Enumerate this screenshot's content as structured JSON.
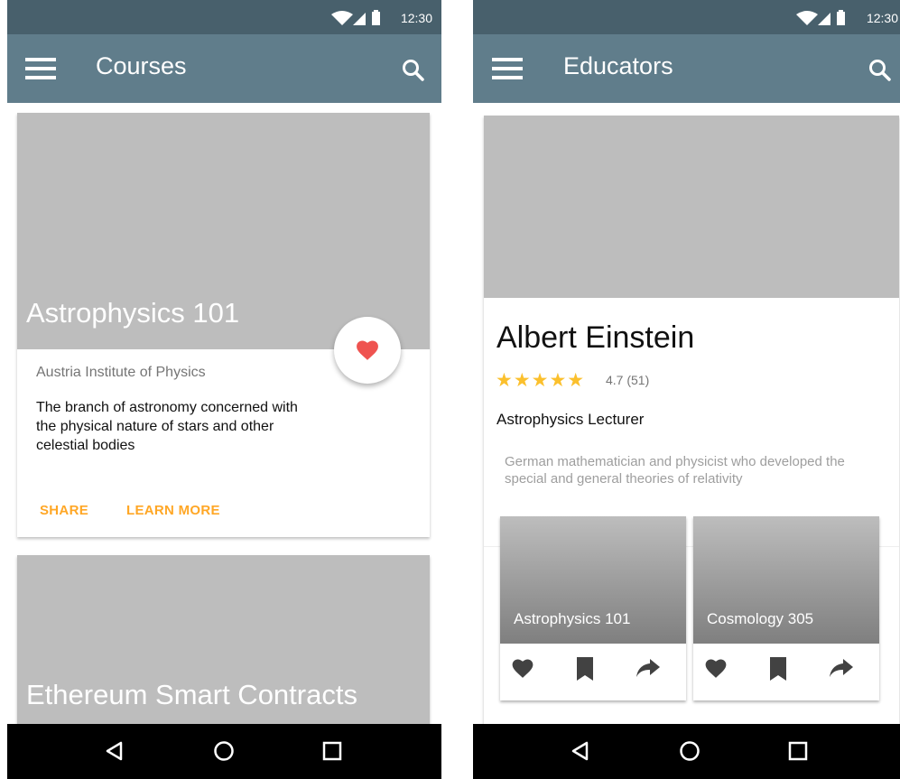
{
  "status_bar": {
    "time": "12:30"
  },
  "courses_screen": {
    "app_bar": {
      "title": "Courses"
    },
    "cards": [
      {
        "title": "Astrophysics 101",
        "institution": "Austria Institute of Physics",
        "description": "The branch of astronomy concerned with the physical nature of stars and other celestial bodies",
        "actions": [
          "SHARE",
          "LEARN MORE"
        ]
      },
      {
        "title": "Ethereum Smart Contracts"
      }
    ]
  },
  "educators_screen": {
    "app_bar": {
      "title": "Educators"
    },
    "educator": {
      "name": "Albert Einstein",
      "stars": "★★★★★",
      "rating": "4.7 (51)",
      "role": "Astrophysics Lecturer",
      "bio": "German mathematician and physicist who developed the special and general theories of relativity"
    },
    "courses": [
      {
        "title": "Astrophysics 101"
      },
      {
        "title": "Cosmology 305"
      }
    ]
  },
  "icons": {
    "menu": "menu-icon",
    "search": "search-icon",
    "favorite": "heart-icon",
    "bookmark": "bookmark-icon",
    "share": "share-icon",
    "back": "back-icon",
    "home": "home-icon",
    "recents": "recents-icon",
    "wifi": "wifi-icon",
    "signal": "signal-icon",
    "battery": "battery-icon"
  },
  "colors": {
    "status_bar": "#48606c",
    "app_bar": "#607d8b",
    "accent": "#ffa726",
    "heart": "#ef5350",
    "star": "#fbc02d",
    "placeholder": "#bdbdbd"
  }
}
